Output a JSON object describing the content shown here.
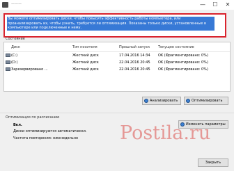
{
  "window": {
    "title": "———",
    "minimize_glyph": "—",
    "maximize_glyph": "☐",
    "close_glyph": "✕"
  },
  "description": "Вы можете оптимизировать диски, чтобы повысить эффективность работы компьютера, или проанализировать их, чтобы узнать, требуется ли оптимизация. Показаны только диски, установленные в компьютере или подключенные к нему.",
  "status_label": "Состояние",
  "table": {
    "columns": [
      "Диск",
      "Тип носителя",
      "Прошлый запуск",
      "Текущее состояние"
    ],
    "rows": [
      {
        "disk": "(C:)",
        "media": "Жесткий диск",
        "last_run": "17.04.2016 14:34",
        "state": "OK (Фрагментировано: 0%)"
      },
      {
        "disk": "(D:)",
        "media": "Жесткий диск",
        "last_run": "22.04.2016 20:45",
        "state": "OK (Фрагментировано: 0%)"
      },
      {
        "disk": "Зарезервировано ...",
        "media": "Жесткий диск",
        "last_run": "22.04.2016 20:45",
        "state": "OK (Фрагментировано: 0%)"
      }
    ]
  },
  "buttons": {
    "analyze": "Анализировать",
    "optimize": "Оптимизировать",
    "change_settings": "Изменить параметры",
    "close": "Закрыть"
  },
  "schedule": {
    "label": "Оптимизация по расписанию",
    "status": "Вкл.",
    "line1": "Диски оптимизируются автоматически.",
    "line2": "Частота повторения: еженедельно"
  },
  "watermark": "Postila.ru"
}
